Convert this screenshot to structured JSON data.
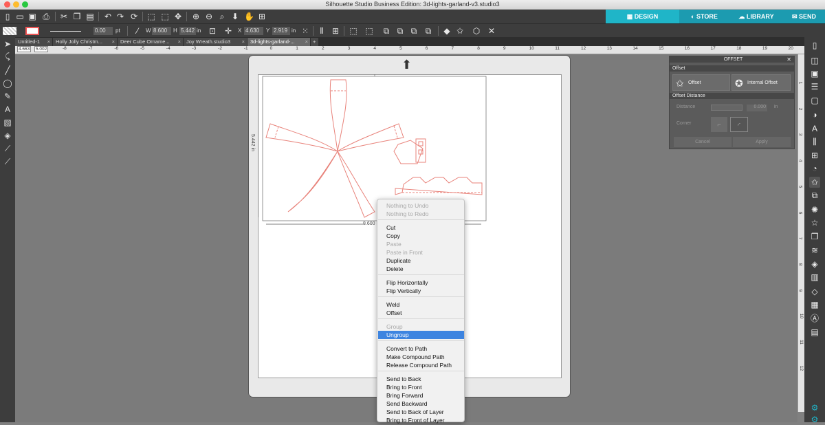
{
  "window": {
    "title": "Silhouette Studio Business Edition: 3d-lights-garland-v3.studio3"
  },
  "nav": {
    "design": "DESIGN",
    "store": "STORE",
    "library": "LIBRARY",
    "send": "SEND"
  },
  "toolbar": {
    "line_width": "0.00",
    "line_unit": "pt",
    "w_label": "W",
    "w_value": "8.600",
    "h_label": "H",
    "h_value": "5.442",
    "size_unit": "in",
    "x_label": "X",
    "x_value": "4.630",
    "y_label": "Y",
    "y_value": "2.919",
    "pos_unit": "in"
  },
  "doc_tabs": [
    "Untitled-1",
    "Holly Jolly Christm...",
    "Deer Cube Orname...",
    "Joy Wreath.studio3",
    "3d-lights-garland-..."
  ],
  "ruler": {
    "coords_x": "4.663",
    "coords_y": "5.002",
    "h_ticks": [
      "-8",
      "-7",
      "-6",
      "-5",
      "-4",
      "-3",
      "-2",
      "-1",
      "0",
      "1",
      "2",
      "3",
      "4",
      "5",
      "6",
      "7",
      "8",
      "9",
      "10",
      "11",
      "12",
      "13",
      "14",
      "15",
      "16",
      "17",
      "18",
      "19",
      "20"
    ],
    "v_ticks": [
      "1",
      "2",
      "3",
      "4",
      "5",
      "6",
      "7",
      "8",
      "9",
      "10",
      "11",
      "12"
    ]
  },
  "selection": {
    "height_label": "5.442 in",
    "width_label": "8.600 in"
  },
  "offset_panel": {
    "title": "OFFSET",
    "section": "Offset",
    "offset_btn": "Offset",
    "internal_offset_btn": "Internal Offset",
    "distance_section": "Offset Distance",
    "distance_label": "Distance",
    "distance_value": "0.000",
    "distance_unit": "in",
    "corner_label": "Corner",
    "cancel": "Cancel",
    "apply": "Apply"
  },
  "context_menu": {
    "items": [
      {
        "label": "Nothing to Undo",
        "disabled": true
      },
      {
        "label": "Nothing to Redo",
        "disabled": true
      },
      {
        "label": "Cut"
      },
      {
        "label": "Copy"
      },
      {
        "label": "Paste",
        "disabled": true
      },
      {
        "label": "Paste in Front",
        "disabled": true
      },
      {
        "label": "Duplicate"
      },
      {
        "label": "Delete"
      },
      {
        "label": "Flip Horizontally"
      },
      {
        "label": "Flip Vertically"
      },
      {
        "label": "Weld"
      },
      {
        "label": "Offset"
      },
      {
        "label": "Group",
        "disabled": true
      },
      {
        "label": "Ungroup",
        "selected": true
      },
      {
        "label": "Convert to Path"
      },
      {
        "label": "Make Compound Path"
      },
      {
        "label": "Release Compound Path"
      },
      {
        "label": "Send to Back"
      },
      {
        "label": "Bring to Front"
      },
      {
        "label": "Bring Forward"
      },
      {
        "label": "Send Backward"
      },
      {
        "label": "Send to Back of Layer"
      },
      {
        "label": "Bring to Front of Layer"
      }
    ]
  },
  "colors": {
    "accent": "#1fb5c8",
    "menu_highlight": "#3d84e0",
    "cut_line": "#e8827a"
  }
}
